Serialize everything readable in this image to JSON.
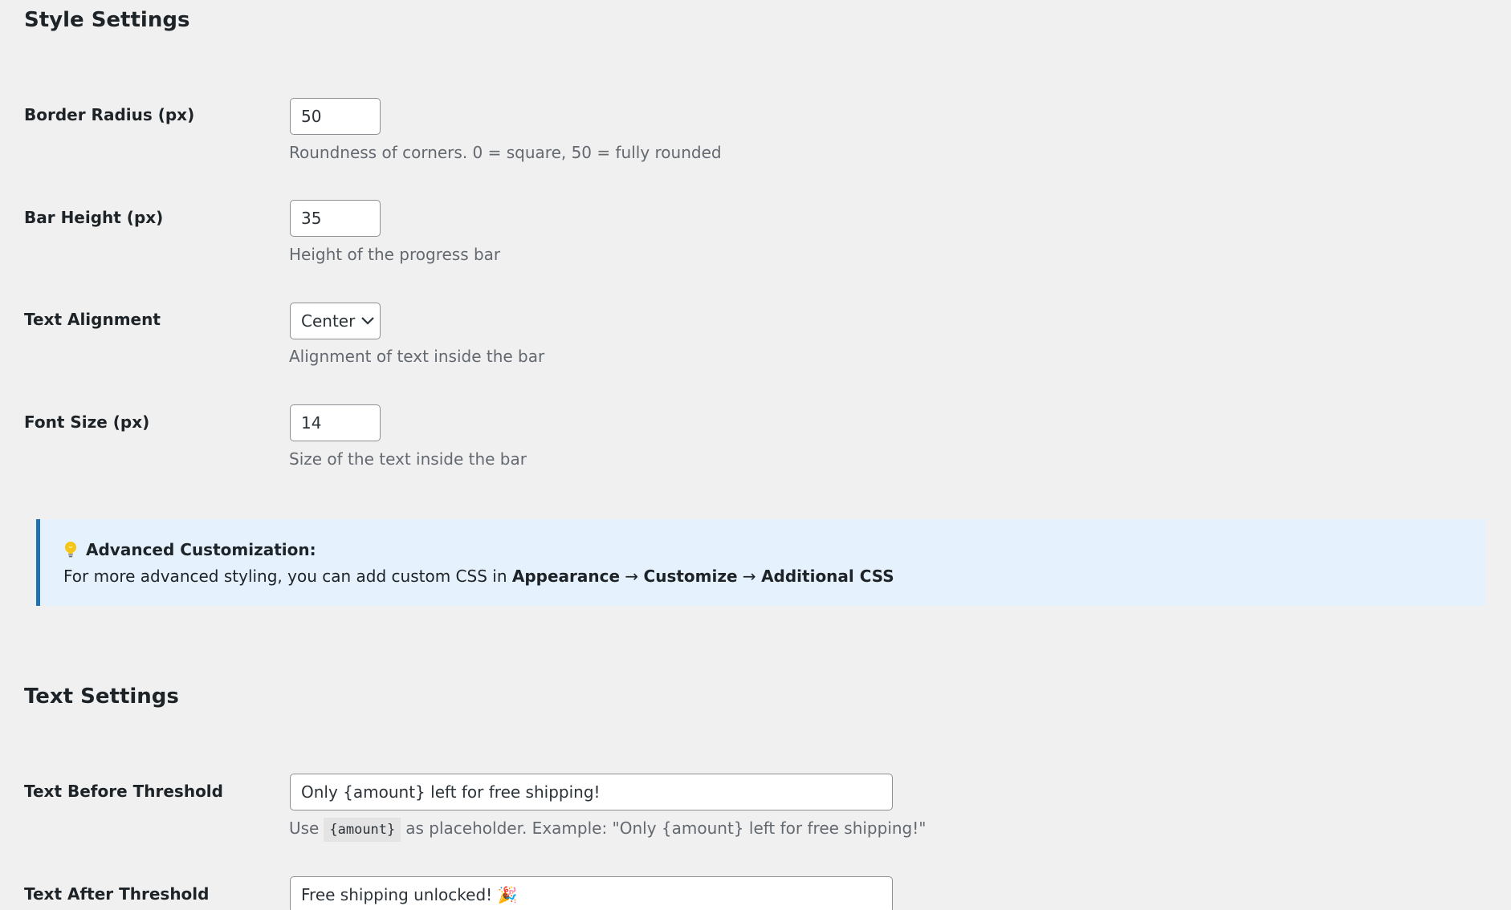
{
  "style_section": {
    "title": "Style Settings",
    "border_radius": {
      "label": "Border Radius (px)",
      "value": "50",
      "description": "Roundness of corners. 0 = square, 50 = fully rounded"
    },
    "bar_height": {
      "label": "Bar Height (px)",
      "value": "35",
      "description": "Height of the progress bar"
    },
    "text_alignment": {
      "label": "Text Alignment",
      "selected": "Center",
      "description": "Alignment of text inside the bar"
    },
    "font_size": {
      "label": "Font Size (px)",
      "value": "14",
      "description": "Size of the text inside the bar"
    }
  },
  "notice": {
    "icon": "lightbulb-icon",
    "title": "Advanced Customization:",
    "text_prefix": "For more advanced styling, you can add custom CSS in ",
    "path_appearance": "Appearance",
    "arrow": " → ",
    "path_customize": "Customize",
    "path_additional_css": "Additional CSS",
    "accent_color": "#2271b1",
    "background_color": "#e5f1fd"
  },
  "text_section": {
    "title": "Text Settings",
    "text_before": {
      "label": "Text Before Threshold",
      "value": "Only {amount} left for free shipping!",
      "desc_prefix": "Use",
      "desc_code": "{amount}",
      "desc_suffix": "as placeholder. Example: \"Only {amount} left for free shipping!\""
    },
    "text_after": {
      "label": "Text After Threshold",
      "value": "Free shipping unlocked! 🎉"
    }
  }
}
